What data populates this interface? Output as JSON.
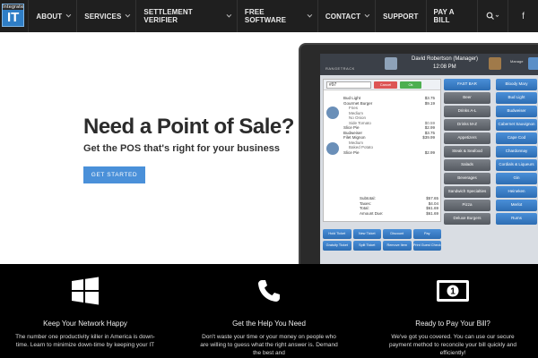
{
  "nav": {
    "logo_top": "Integrate",
    "logo_text": "IT",
    "items": [
      {
        "label": "About",
        "caret": true
      },
      {
        "label": "Services",
        "caret": true
      },
      {
        "label": "Settlement Verifier",
        "caret": true
      },
      {
        "label": "Free Software",
        "caret": true
      },
      {
        "label": "Contact",
        "caret": true
      },
      {
        "label": "Support",
        "caret": false
      },
      {
        "label": "Pay a Bill",
        "caret": false
      }
    ],
    "search_icon": "search-icon",
    "facebook_label": "f"
  },
  "hero": {
    "title": "Need a Point of Sale?",
    "subtitle": "Get the POS that's right for your business",
    "cta_label": "GET STARTED"
  },
  "pos": {
    "brand": "RANGETRACK",
    "user": "David Robertson (Manager)",
    "time": "12:08 PM",
    "manage_label": "Manage",
    "ticket_number": "#97",
    "cancel_label": "Cancel",
    "ok_label": "Ok",
    "lines": [
      {
        "name": "Bud Light",
        "price": "$3.75",
        "mod": false
      },
      {
        "name": "Gourmet Burger",
        "price": "$9.19",
        "mod": false
      },
      {
        "name": "Fries",
        "price": "",
        "mod": true
      },
      {
        "name": "Medium",
        "price": "",
        "mod": true
      },
      {
        "name": "No Onion",
        "price": "",
        "mod": true
      },
      {
        "name": "Side Tomato",
        "price": "$0.59",
        "mod": true
      },
      {
        "name": "Slice Pie",
        "price": "$2.99",
        "mod": false
      },
      {
        "name": "Budweiser",
        "price": "$3.75",
        "mod": false
      },
      {
        "name": "Filet Mignon",
        "price": "$39.99",
        "mod": false
      },
      {
        "name": "Medium",
        "price": "",
        "mod": true
      },
      {
        "name": "Baked Potato",
        "price": "",
        "mod": true
      },
      {
        "name": "Slice Pie",
        "price": "$2.99",
        "mod": false
      }
    ],
    "totals": [
      {
        "label": "Subtotal:",
        "value": "$57.65"
      },
      {
        "label": "Taxes:",
        "value": "$4.04"
      },
      {
        "label": "Total:",
        "value": "$61.69"
      },
      {
        "label": "Amount Due:",
        "value": "$61.69"
      }
    ],
    "categories": [
      "FAST BAR",
      "Beer",
      "Drinks A-L",
      "Drinks M-Z",
      "Appetizers",
      "Steak & Seafood",
      "Salads",
      "Beverages",
      "Sandwich Specialties",
      "Pizza",
      "Deluxe Burgers"
    ],
    "items": [
      "Bloody Mary",
      "Bud Light",
      "Budweiser",
      "Cabernet Sauvignon",
      "Cape Cod",
      "Chardonnay",
      "Cordials & Liqueurs",
      "Gin",
      "Heineken",
      "Merlot",
      "Rums"
    ],
    "bottom_buttons": [
      "Hold Ticket",
      "New Ticket",
      "Discount",
      "Pay",
      "Gratuity Ticket",
      "Split Ticket",
      "Remove Item",
      "Print Guest Check"
    ]
  },
  "features": [
    {
      "icon": "windows-icon",
      "title": "Keep Your Network Happy",
      "desc": "The number one productivity killer in America is down-time. Learn to minimize down-time by keeping your IT"
    },
    {
      "icon": "phone-icon",
      "title": "Get the Help You Need",
      "desc": "Don't waste your time or your money on people who are willing to guess what the right answer is. Demand the best and"
    },
    {
      "icon": "money-icon",
      "title": "Ready to Pay Your Bill?",
      "desc": "We've got you covered. You can use our secure payment method to reconcile your bill quickly and efficiently!"
    }
  ]
}
